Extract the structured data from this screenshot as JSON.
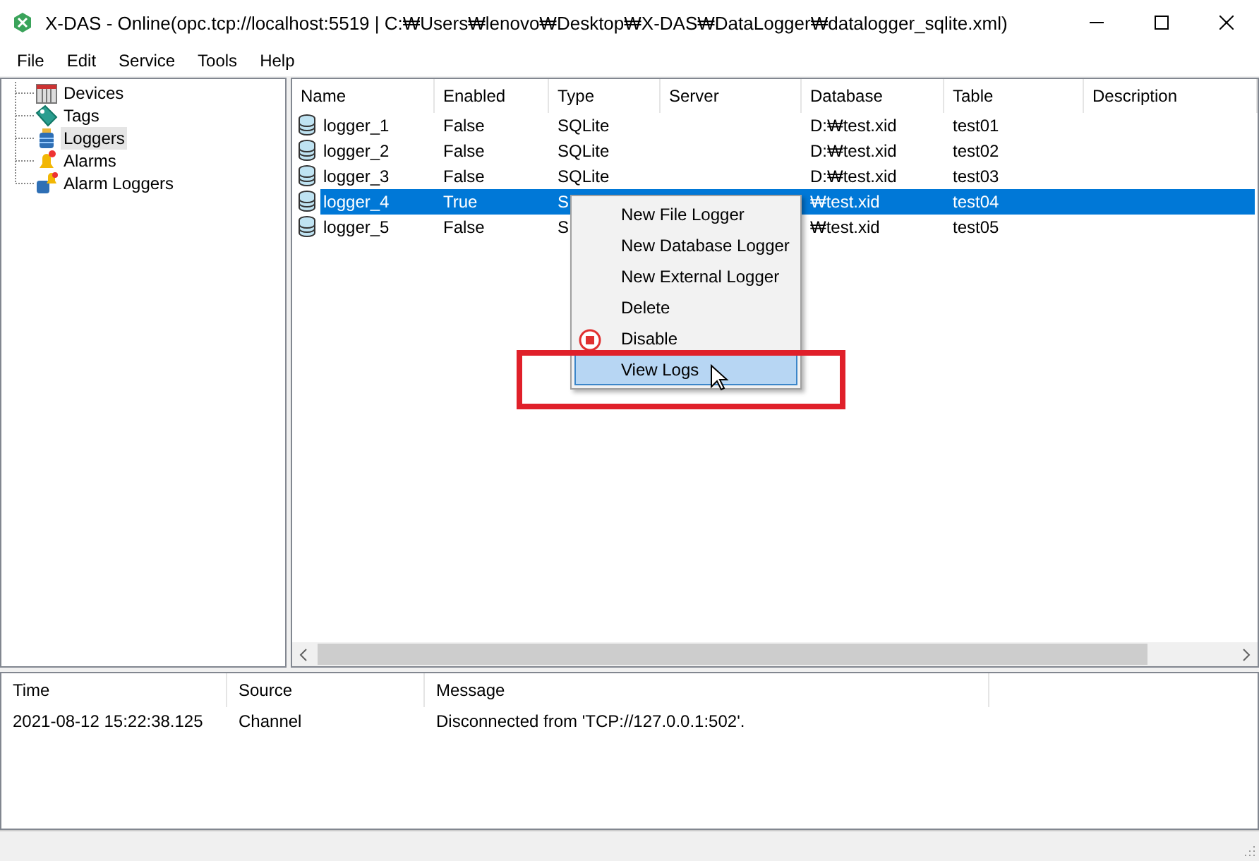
{
  "window": {
    "title": "X-DAS - Online(opc.tcp://localhost:5519 | C:₩Users₩lenovo₩Desktop₩X-DAS₩DataLogger₩datalogger_sqlite.xml)"
  },
  "menu": [
    "File",
    "Edit",
    "Service",
    "Tools",
    "Help"
  ],
  "tree": [
    {
      "label": "Devices",
      "kind": "devices",
      "selected": false
    },
    {
      "label": "Tags",
      "kind": "tags",
      "selected": false
    },
    {
      "label": "Loggers",
      "kind": "loggers",
      "selected": true
    },
    {
      "label": "Alarms",
      "kind": "alarms",
      "selected": false
    },
    {
      "label": "Alarm Loggers",
      "kind": "alarm_loggers",
      "selected": false
    }
  ],
  "table": {
    "columns": [
      "Name",
      "Enabled",
      "Type",
      "Server",
      "Database",
      "Table",
      "Description"
    ],
    "rows": [
      {
        "cells": [
          "logger_1",
          "False",
          "SQLite",
          "",
          "D:₩test.xid",
          "test01",
          ""
        ],
        "selected": false
      },
      {
        "cells": [
          "logger_2",
          "False",
          "SQLite",
          "",
          "D:₩test.xid",
          "test02",
          ""
        ],
        "selected": false
      },
      {
        "cells": [
          "logger_3",
          "False",
          "SQLite",
          "",
          "D:₩test.xid",
          "test03",
          ""
        ],
        "selected": false
      },
      {
        "cells": [
          "logger_4",
          "True",
          "S",
          "",
          "₩test.xid",
          "test04",
          ""
        ],
        "selected": true
      },
      {
        "cells": [
          "logger_5",
          "False",
          "S",
          "",
          "₩test.xid",
          "test05",
          ""
        ],
        "selected": false
      }
    ]
  },
  "context_menu": [
    {
      "label": "New File Logger",
      "icon": false,
      "selected": false
    },
    {
      "label": "New Database Logger",
      "icon": false,
      "selected": false
    },
    {
      "label": "New External Logger",
      "icon": false,
      "selected": false
    },
    {
      "label": "Delete",
      "icon": false,
      "selected": false
    },
    {
      "label": "Disable",
      "icon": true,
      "selected": false
    },
    {
      "label": "View Logs",
      "icon": false,
      "selected": true
    }
  ],
  "log": {
    "columns": [
      "Time",
      "Source",
      "Message"
    ],
    "rows": [
      [
        "2021-08-12 15:22:38.125",
        "Channel",
        "Disconnected from 'TCP://127.0.0.1:502'."
      ]
    ]
  }
}
